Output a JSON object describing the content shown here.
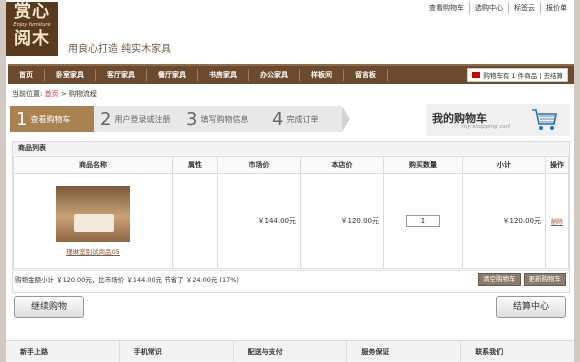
{
  "logo": {
    "line1": "赏心",
    "line2": "Enjoy furniture",
    "line3": "阅木"
  },
  "slogan": "用良心打造 纯实木家具",
  "top_links": [
    "查看购物车",
    "选购中心",
    "标签云",
    "报价单"
  ],
  "nav": {
    "items": [
      "首页",
      "卧室家具",
      "客厅家具",
      "餐厅家具",
      "书房家具",
      "办公家具",
      "样板间",
      "留言板"
    ],
    "cart_text": "购物车有 1 件商品 | 去结算"
  },
  "breadcrumb": {
    "prefix": "当前位置:",
    "home": "首页",
    "sep": ">",
    "current": "购物流程"
  },
  "steps": [
    {
      "num": "1",
      "label": "查看购物车"
    },
    {
      "num": "2",
      "label": "用户登录或注册"
    },
    {
      "num": "3",
      "label": "填写购物信息"
    },
    {
      "num": "4",
      "label": "完成订单"
    }
  ],
  "mycart": {
    "title": "我的购物车",
    "subtitle": "my shopping cart"
  },
  "list": {
    "title": "商品列表",
    "headers": [
      "商品名称",
      "属性",
      "市场价",
      "本店价",
      "购买数量",
      "小计",
      "操作"
    ],
    "row": {
      "name": "瑾琳室别试商品05",
      "attr": "",
      "market_price": "￥144.00元",
      "shop_price": "￥120.00元",
      "qty": "1",
      "subtotal": "￥120.00元",
      "action": "删除"
    },
    "summary": "购物金额小计 ￥120.00元，比市场价 ￥144.00元 节省了 ￥24.00元 (17%)",
    "clear_button": "清空购物车",
    "update_button": "更新购物车"
  },
  "buttons": {
    "continue": "继续购物",
    "checkout": "结算中心"
  },
  "footer": [
    "新手上路",
    "手机常识",
    "配送与支付",
    "服务保证",
    "联系我们"
  ]
}
